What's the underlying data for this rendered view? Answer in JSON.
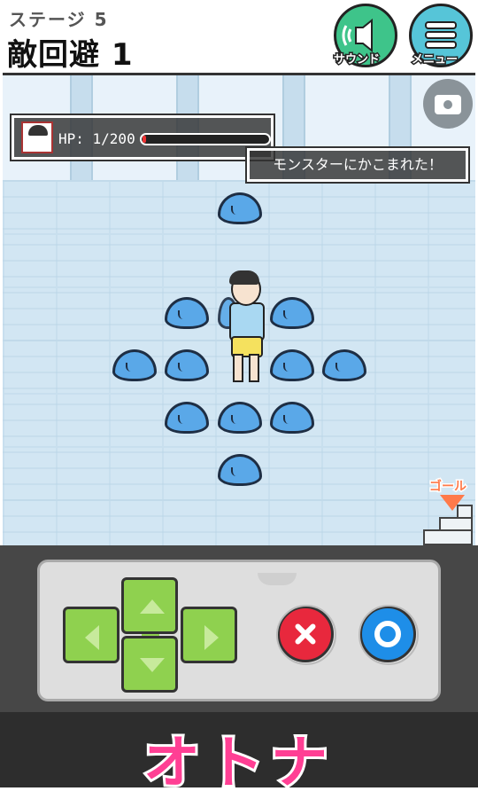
{
  "header": {
    "stage_label": "ステージ 5",
    "stage_title": "敵回避 1",
    "sound_button_label": "サウンド",
    "menu_button_label": "メニュー",
    "sound_icon": "speaker-wave-icon",
    "menu_icon": "hamburger-icon"
  },
  "game": {
    "hp_text": "HP: 1/200",
    "hp_current": 1,
    "hp_max": 200,
    "message": "モンスターにかこまれた！",
    "camera_icon": "camera-icon",
    "goal_label": "ゴール",
    "slime_count": 12
  },
  "controller": {
    "dpad_icons": [
      "arrow-up-icon",
      "arrow-left-icon",
      "arrow-right-icon",
      "arrow-down-icon"
    ],
    "x_button_icon": "cross-icon",
    "o_button_icon": "circle-icon"
  },
  "banner": {
    "text": "オトナ"
  },
  "colors": {
    "hp_fill": "#e33333",
    "slime": "#5aa8e8",
    "dpad": "#8fd14f",
    "x_button": "#e8283d",
    "o_button": "#1e8ee8",
    "banner_text": "#ff3f94",
    "sound_button": "#3ec48a",
    "menu_button": "#56c5d8"
  }
}
